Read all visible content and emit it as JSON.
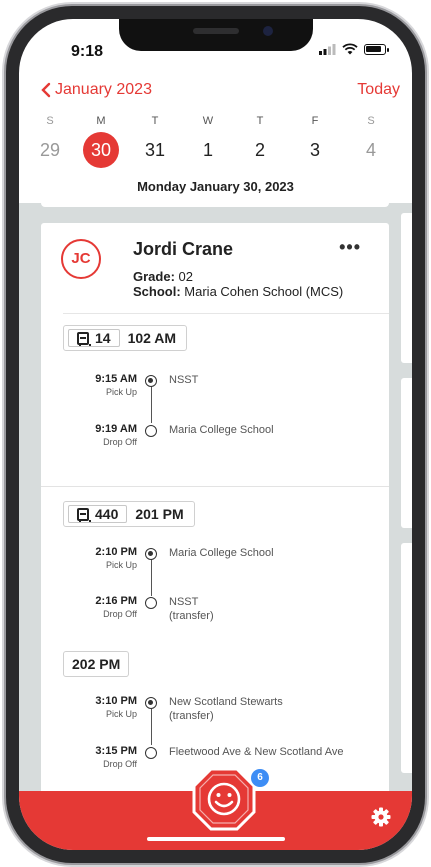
{
  "status_bar": {
    "time": "9:18"
  },
  "header": {
    "month_label": "January 2023",
    "today_label": "Today"
  },
  "week": {
    "days": [
      {
        "dow": "S",
        "num": "29",
        "weekend": true
      },
      {
        "dow": "M",
        "num": "30",
        "selected": true
      },
      {
        "dow": "T",
        "num": "31"
      },
      {
        "dow": "W",
        "num": "1"
      },
      {
        "dow": "T",
        "num": "2"
      },
      {
        "dow": "F",
        "num": "3"
      },
      {
        "dow": "S",
        "num": "4",
        "weekend": true
      }
    ],
    "selected_date": "Monday January 30, 2023"
  },
  "student": {
    "initials": "JC",
    "name": "Jordi Crane",
    "grade_label": "Grade:",
    "grade": "02",
    "school_label": "School:",
    "school": "Maria Cohen School (MCS)",
    "more_label": "•••"
  },
  "routes": [
    {
      "bus": "14",
      "name": "102 AM",
      "stops": [
        {
          "time": "9:15 AM",
          "kind": "Pick Up",
          "place": "NSST"
        },
        {
          "time": "9:19 AM",
          "kind": "Drop Off",
          "place": "Maria College School"
        }
      ]
    },
    {
      "bus": "440",
      "name": "201 PM",
      "stops": [
        {
          "time": "2:10 PM",
          "kind": "Pick Up",
          "place": "Maria College School"
        },
        {
          "time": "2:16 PM",
          "kind": "Drop Off",
          "place": "NSST",
          "note": "(transfer)"
        }
      ]
    },
    {
      "bus": "",
      "name": "202 PM",
      "stops": [
        {
          "time": "3:10 PM",
          "kind": "Pick Up",
          "place": "New Scotland Stewarts",
          "note": "(transfer)"
        },
        {
          "time": "3:15 PM",
          "kind": "Drop Off",
          "place": "Fleetwood Ave & New Scotland Ave"
        }
      ]
    }
  ],
  "tabbar": {
    "badge_count": "6"
  },
  "colors": {
    "accent": "#e53935",
    "badge": "#3d8df5",
    "background": "#d7dcdc"
  },
  "icons": [
    "chevron-left-icon",
    "bus-icon",
    "stop-sign-icon",
    "gear-icon",
    "signal-icon",
    "wifi-icon",
    "battery-icon"
  ]
}
